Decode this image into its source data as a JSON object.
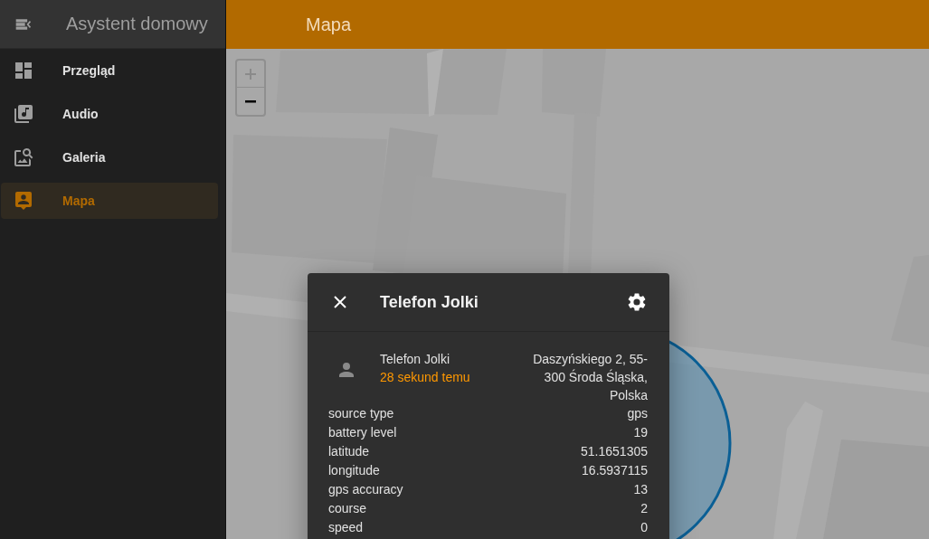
{
  "sidebar": {
    "title": "Asystent domowy",
    "items": [
      {
        "label": "Przegląd",
        "kind": "dashboard",
        "selected": false
      },
      {
        "label": "Audio",
        "kind": "music",
        "selected": false
      },
      {
        "label": "Galeria",
        "kind": "gallery",
        "selected": false
      },
      {
        "label": "Mapa",
        "kind": "map",
        "selected": true
      }
    ]
  },
  "toolbar": {
    "title": "Mapa"
  },
  "dialog": {
    "title": "Telefon Jolki",
    "entity": {
      "name": "Telefon Jolki",
      "last_changed": "28 sekund temu",
      "state": "Daszyńskiego 2, 55-300 Środa Śląska, Polska"
    },
    "attributes": [
      {
        "name": "source type",
        "value": "gps"
      },
      {
        "name": "battery level",
        "value": "19"
      },
      {
        "name": "latitude",
        "value": "51.1651305"
      },
      {
        "name": "longitude",
        "value": "16.5937115"
      },
      {
        "name": "gps accuracy",
        "value": "13"
      },
      {
        "name": "course",
        "value": "2"
      },
      {
        "name": "speed",
        "value": "0"
      }
    ]
  }
}
